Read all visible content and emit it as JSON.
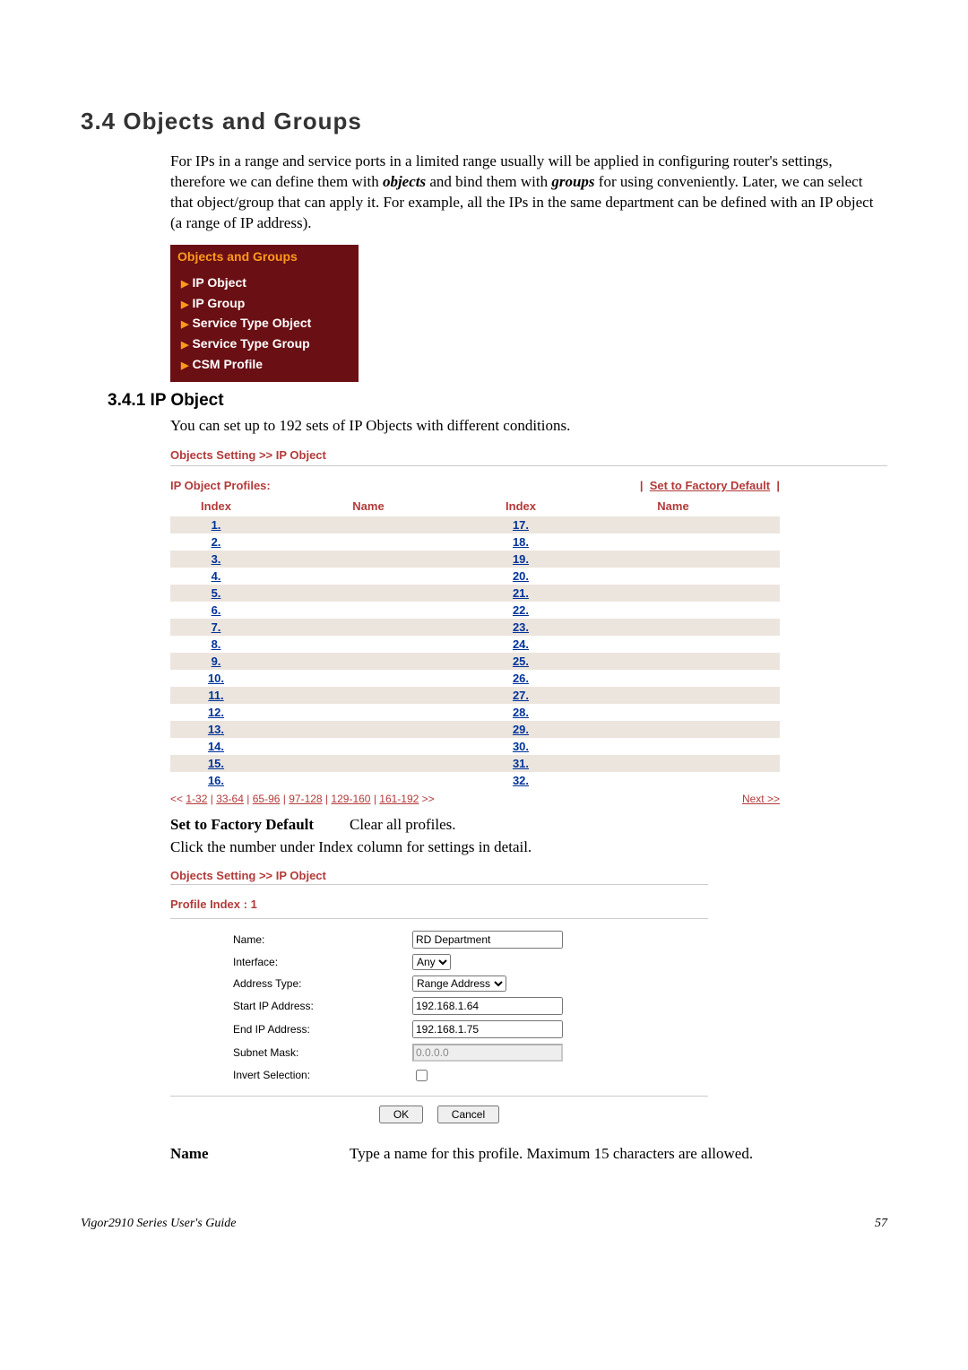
{
  "section_title": "3.4 Objects and Groups",
  "intro": "For IPs in a range and service ports in a limited range usually will be applied in configuring router's settings, therefore we can define them with objects and bind them with groups for using conveniently. Later, we can select that object/group that can apply it. For example, all the IPs in the same department can be defined with an IP object (a range of IP address).",
  "menu": {
    "title": "Objects and Groups",
    "items": [
      "IP Object",
      "IP Group",
      "Service Type Object",
      "Service Type Group",
      "CSM Profile"
    ]
  },
  "subsection": "3.4.1 IP Object",
  "sub_intro": "You can set up to 192 sets of IP Objects with different conditions.",
  "crumb": "Objects Setting >> IP Object",
  "profiles": {
    "title": "IP Object Profiles:",
    "reset_label": "Set to Factory Default",
    "cols": [
      "Index",
      "Name",
      "Index",
      "Name"
    ],
    "left_indices": [
      "1.",
      "2.",
      "3.",
      "4.",
      "5.",
      "6.",
      "7.",
      "8.",
      "9.",
      "10.",
      "11.",
      "12.",
      "13.",
      "14.",
      "15.",
      "16."
    ],
    "right_indices": [
      "17.",
      "18.",
      "19.",
      "20.",
      "21.",
      "22.",
      "23.",
      "24.",
      "25.",
      "26.",
      "27.",
      "28.",
      "29.",
      "30.",
      "31.",
      "32."
    ],
    "pager_prev": "<<",
    "pager_ranges": [
      "1-32",
      "33-64",
      "65-96",
      "97-128",
      "129-160",
      "161-192"
    ],
    "pager_suffix": ">>",
    "next_label": "Next >>"
  },
  "def1_term": "Set to Factory Default",
  "def1_desc": "Clear all profiles.",
  "click_note": "Click the number under Index column for settings in detail.",
  "form": {
    "crumb": "Objects Setting >> IP Object",
    "title": "Profile Index : 1",
    "labels": {
      "name": "Name:",
      "interface": "Interface:",
      "addrtype": "Address Type:",
      "startip": "Start IP Address:",
      "endip": "End IP Address:",
      "subnet": "Subnet Mask:",
      "invert": "Invert Selection:"
    },
    "values": {
      "name": "RD Department",
      "interface": "Any",
      "addrtype": "Range Address",
      "startip": "192.168.1.64",
      "endip": "192.168.1.75",
      "subnet": "0.0.0.0"
    },
    "ok": "OK",
    "cancel": "Cancel"
  },
  "def2_term": "Name",
  "def2_desc": "Type a name for this profile. Maximum 15 characters are allowed.",
  "footer_left": "Vigor2910 Series User's Guide",
  "footer_right": "57"
}
